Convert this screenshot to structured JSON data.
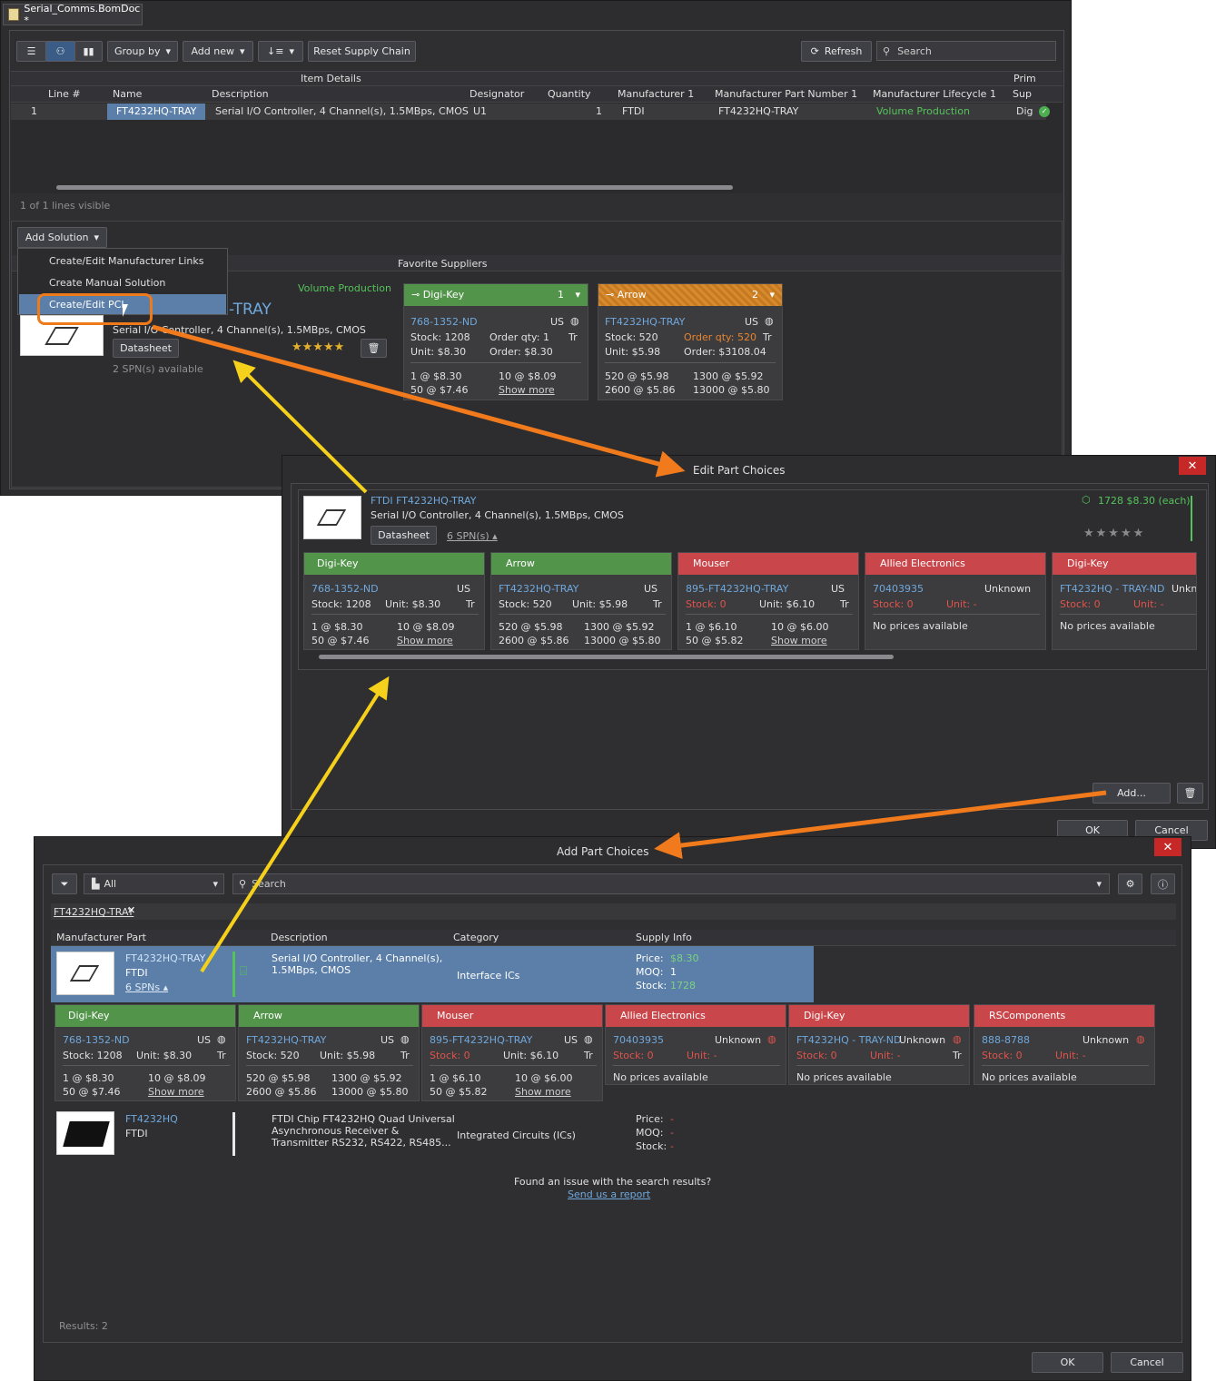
{
  "main": {
    "tab_title": "Serial_Comms.BomDoc *",
    "toolbar": {
      "group_by": "Group by",
      "add_new": "Add new",
      "reset": "Reset Supply Chain",
      "refresh": "Refresh",
      "search_placeholder": "Search"
    },
    "group_item_details": "Item Details",
    "group_prim": "Prim",
    "columns": [
      "Line #",
      "Name",
      "Description",
      "Designator",
      "Quantity",
      "Manufacturer 1",
      "Manufacturer Part Number 1",
      "Manufacturer Lifecycle 1",
      "Sup"
    ],
    "row": {
      "line": "1",
      "name": "FT4232HQ-TRAY",
      "description": "Serial I/O Controller, 4 Channel(s), 1.5MBps, CMOS",
      "designator": "U1",
      "quantity": "1",
      "manufacturer": "FTDI",
      "mpn": "FT4232HQ-TRAY",
      "lifecycle": "Volume Production",
      "sup": "Dig"
    },
    "lines_visible": "1 of 1 lines visible",
    "add_solution": "Add Solution",
    "menu": [
      "Create/Edit Manufacturer Links",
      "Create Manual Solution",
      "Create/Edit PCL"
    ],
    "favorite_suppliers": "Favorite Suppliers",
    "solution": {
      "lifecycle": "Volume Production",
      "mpn_tail": "-TRAY",
      "desc": "Serial I/O Controller, 4 Channel(s), 1.5MBps, CMOS",
      "datasheet": "Datasheet",
      "spn": "2 SPN(s) available",
      "stars": "★★★★★"
    },
    "cards": [
      {
        "name": "Digi-Key",
        "rank": "1",
        "pn": "768-1352-ND",
        "region": "US",
        "stock": "Stock: 1208",
        "order_qty": "Order qty: 1",
        "unit": "Unit: $8.30",
        "order": "Order: $8.30",
        "tr": "Tr",
        "p1": "1 @ $8.30",
        "p2": "10 @ $8.09",
        "p3": "50 @ $7.46",
        "more": "Show more"
      },
      {
        "name": "Arrow",
        "rank": "2",
        "pn": "FT4232HQ-TRAY",
        "region": "US",
        "stock": "Stock: 520",
        "order_qty": "Order qty: 520",
        "unit": "Unit: $5.98",
        "order": "Order: $3108.04",
        "tr": "Tr",
        "p1": "520 @ $5.98",
        "p2": "1300 @ $5.92",
        "p3": "2600 @ $5.86",
        "p4": "13000 @ $5.80"
      }
    ]
  },
  "edit": {
    "title": "Edit Part Choices",
    "part": "FTDI FT4232HQ-TRAY",
    "desc": "Serial I/O Controller, 4 Channel(s), 1.5MBps, CMOS",
    "datasheet": "Datasheet",
    "spn": "6 SPN(s) ▴",
    "stock_info": "1728  $8.30 (each)",
    "stars": "★★★★★",
    "cards": [
      {
        "name": "Digi-Key",
        "pn": "768-1352-ND",
        "region": "US",
        "stock": "Stock: 1208",
        "unit": "Unit: $8.30",
        "tr": "Tr",
        "p1": "1 @ $8.30",
        "p2": "10 @ $8.09",
        "p3": "50 @ $7.46",
        "more": "Show more"
      },
      {
        "name": "Arrow",
        "pn": "FT4232HQ-TRAY",
        "region": "US",
        "stock": "Stock: 520",
        "unit": "Unit: $5.98",
        "tr": "Tr",
        "p1": "520 @ $5.98",
        "p2": "1300 @ $5.92",
        "p3": "2600 @ $5.86",
        "p4": "13000 @ $5.80"
      },
      {
        "name": "Mouser",
        "pn": "895-FT4232HQ-TRAY",
        "region": "US",
        "stock": "Stock: 0",
        "unit": "Unit: $6.10",
        "tr": "Tr",
        "p1": "1 @ $6.10",
        "p2": "10 @ $6.00",
        "p3": "50 @ $5.82",
        "more": "Show more"
      },
      {
        "name": "Allied Electronics",
        "pn": "70403935",
        "region": "Unknown",
        "stock": "Stock: 0",
        "unit": "Unit: -",
        "np": "No prices available"
      },
      {
        "name": "Digi-Key",
        "pn": "FT4232HQ - TRAY-ND",
        "region": "Unkn",
        "stock": "Stock: 0",
        "unit": "Unit: -",
        "np": "No prices available"
      }
    ],
    "add": "Add...",
    "ok": "OK",
    "cancel": "Cancel"
  },
  "addp": {
    "title": "Add Part Choices",
    "filter": "All",
    "search_placeholder": "Search",
    "chip": "FT4232HQ-TRAY",
    "columns": [
      "Manufacturer Part",
      "Description",
      "Category",
      "Supply Info"
    ],
    "r1": {
      "mpn": "FT4232HQ-TRAY",
      "mfr": "FTDI",
      "spns": "6 SPNs ▴",
      "desc1": "Serial I/O Controller, 4 Channel(s),",
      "desc2": "1.5MBps, CMOS",
      "category": "Interface ICs",
      "price_l": "Price:",
      "price": "$8.30",
      "moq_l": "MOQ:",
      "moq": "1",
      "stock_l": "Stock:",
      "stock": "1728"
    },
    "cards": [
      {
        "name": "Digi-Key",
        "pn": "768-1352-ND",
        "region": "US",
        "stock": "Stock: 1208",
        "unit": "Unit: $8.30",
        "tr": "Tr",
        "p1": "1 @ $8.30",
        "p2": "10 @ $8.09",
        "p3": "50 @ $7.46",
        "more": "Show more"
      },
      {
        "name": "Arrow",
        "pn": "FT4232HQ-TRAY",
        "region": "US",
        "stock": "Stock: 520",
        "unit": "Unit: $5.98",
        "tr": "Tr",
        "p1": "520 @ $5.98",
        "p2": "1300 @ $5.92",
        "p3": "2600 @ $5.86",
        "p4": "13000 @ $5.80"
      },
      {
        "name": "Mouser",
        "pn": "895-FT4232HQ-TRAY",
        "region": "US",
        "stock": "Stock: 0",
        "unit": "Unit: $6.10",
        "tr": "Tr",
        "p1": "1 @ $6.10",
        "p2": "10 @ $6.00",
        "p3": "50 @ $5.82",
        "more": "Show more"
      },
      {
        "name": "Allied Electronics",
        "pn": "70403935",
        "region": "Unknown",
        "stock": "Stock: 0",
        "unit": "Unit: -",
        "np": "No prices available"
      },
      {
        "name": "Digi-Key",
        "pn": "FT4232HQ - TRAY-ND",
        "region": "Unknown",
        "stock": "Stock: 0",
        "unit": "Unit: -",
        "tr": "Tr",
        "np": "No prices available"
      },
      {
        "name": "RSComponents",
        "pn": "888-8788",
        "region": "Unknown",
        "stock": "Stock: 0",
        "unit": "Unit: -",
        "np": "No prices available"
      }
    ],
    "r2": {
      "mpn": "FT4232HQ",
      "mfr": "FTDI",
      "desc1": "FTDI Chip FT4232HQ Quad Universal",
      "desc2": "Asynchronous Receiver &",
      "desc3": "Transmitter RS232, RS422, RS485...",
      "category": "Integrated Circuits (ICs)",
      "price_l": "Price:",
      "price": "-",
      "moq_l": "MOQ:",
      "moq": "-",
      "stock_l": "Stock:",
      "stock": "-"
    },
    "issue": "Found an issue with the search results?",
    "report": "Send us a report",
    "results": "Results: 2",
    "ok": "OK",
    "cancel": "Cancel"
  }
}
